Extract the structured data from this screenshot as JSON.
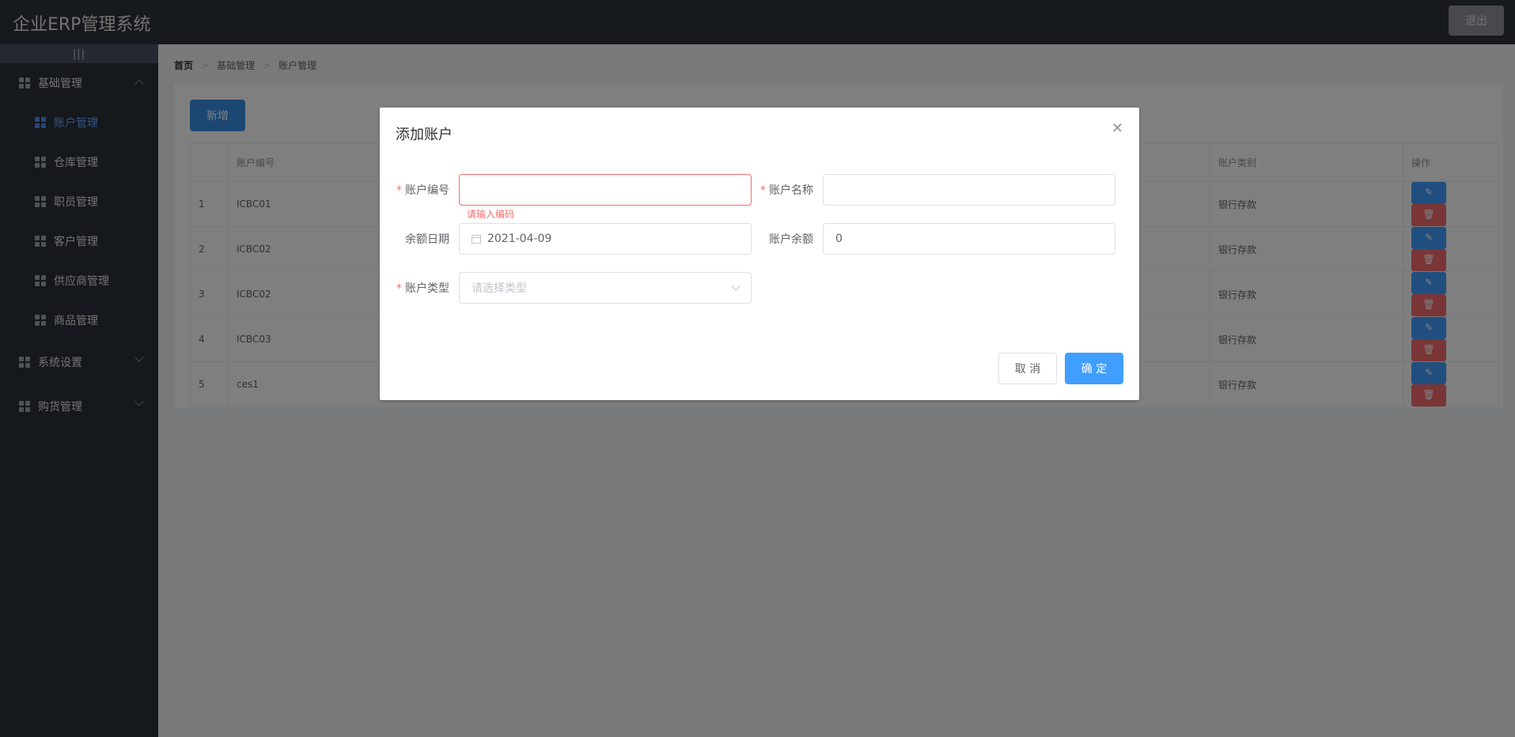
{
  "header": {
    "title": "企业ERP管理系统",
    "logout_label": "退出"
  },
  "sidebar": {
    "collapse_label": "|||",
    "groups": [
      {
        "label": "基础管理",
        "expanded": true
      },
      {
        "label": "系统设置",
        "expanded": false
      },
      {
        "label": "购货管理",
        "expanded": false
      }
    ],
    "subitems": [
      {
        "label": "账户管理",
        "active": true
      },
      {
        "label": "仓库管理"
      },
      {
        "label": "职员管理"
      },
      {
        "label": "客户管理"
      },
      {
        "label": "供应商管理"
      },
      {
        "label": "商品管理"
      }
    ]
  },
  "breadcrumb": [
    "首页",
    "基础管理",
    "账户管理"
  ],
  "toolbar": {
    "add_label": "新增"
  },
  "table": {
    "headers": {
      "index": "",
      "code": "账户编号",
      "type": "账户类别",
      "ops": "操作"
    },
    "rows": [
      {
        "index": "1",
        "code": "ICBC01",
        "type": "银行存款"
      },
      {
        "index": "2",
        "code": "ICBC02",
        "type": "银行存款"
      },
      {
        "index": "3",
        "code": "ICBC02",
        "type": "银行存款"
      },
      {
        "index": "4",
        "code": "ICBC03",
        "type": "银行存款"
      },
      {
        "index": "5",
        "code": "ces1",
        "type": "银行存款"
      }
    ]
  },
  "dialog": {
    "title": "添加账户",
    "close_icon": "close-icon",
    "fields": {
      "code_label": "账户编号",
      "code_value": "",
      "code_error": "请输入编码",
      "name_label": "账户名称",
      "name_value": "",
      "date_label": "余额日期",
      "date_value": "2021-04-09",
      "balance_label": "账户余额",
      "balance_value": "0",
      "type_label": "账户类型",
      "type_placeholder": "请选择类型"
    },
    "cancel_label": "取 消",
    "ok_label": "确 定"
  },
  "colors": {
    "primary": "#409eff",
    "danger": "#f56c6c",
    "header_bg": "#2d333b",
    "sidebar_bg": "#2b3038"
  }
}
